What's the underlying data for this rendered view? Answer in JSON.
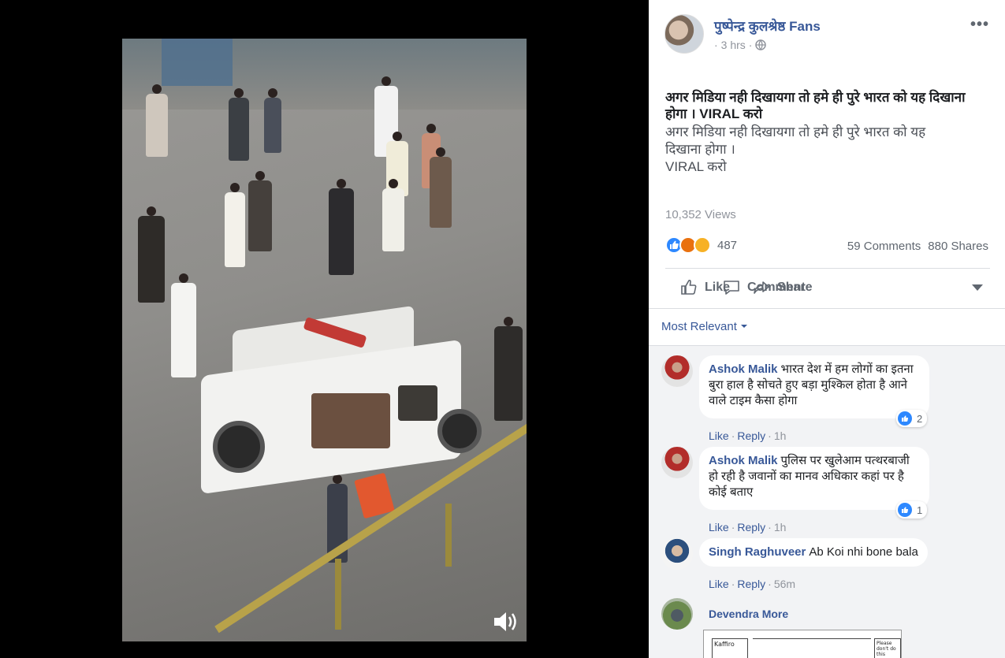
{
  "post": {
    "page_name": "पुष्पेन्द्र कुलश्रेष्ठ Fans",
    "time": "3 hrs",
    "privacy_icon": "globe-icon",
    "title": "अगर मिडिया नही दिखायगा तो हमे ही पुरे भारत को यह दिखाना होगा । VIRAL करो",
    "body": "अगर मिडिया नही दिखायगा तो हमे ही पुरे भारत को यह\nदिखाना होगा ।\nVIRAL करो",
    "views": "10,352 Views",
    "reaction_count": "487",
    "comments_count": "59 Comments",
    "shares_count": "880 Shares"
  },
  "actions": {
    "like": "Like",
    "comment": "Comment",
    "share": "Share"
  },
  "filter": "Most Relevant",
  "comments": [
    {
      "author": "Ashok Malik",
      "text": "भारत देश में हम लोगों का इतना बुरा हाल है सोचते हुए बड़ा मुश्किल होता है आने वाले टाइम कैसा होगा",
      "like": "Like",
      "reply": "Reply",
      "time": "1h",
      "reactions": "2"
    },
    {
      "author": "Ashok Malik",
      "text": "पुलिस पर खुलेआम पत्थरबाजी हो रही है जवानों का मानव अधिकार कहां पर है कोई बताए",
      "like": "Like",
      "reply": "Reply",
      "time": "1h",
      "reactions": "1"
    },
    {
      "author": "Singh Raghuveer",
      "text": "Ab Koi nhi bone bala",
      "like": "Like",
      "reply": "Reply",
      "time": "56m"
    },
    {
      "author": "Devendra More",
      "image_text": [
        "Kaffiro",
        "Please don't do this"
      ]
    }
  ],
  "colors": {
    "link": "#385898",
    "like_blue": "#2d88ff",
    "angry": "#e9710f",
    "sad": "#f7b125"
  }
}
